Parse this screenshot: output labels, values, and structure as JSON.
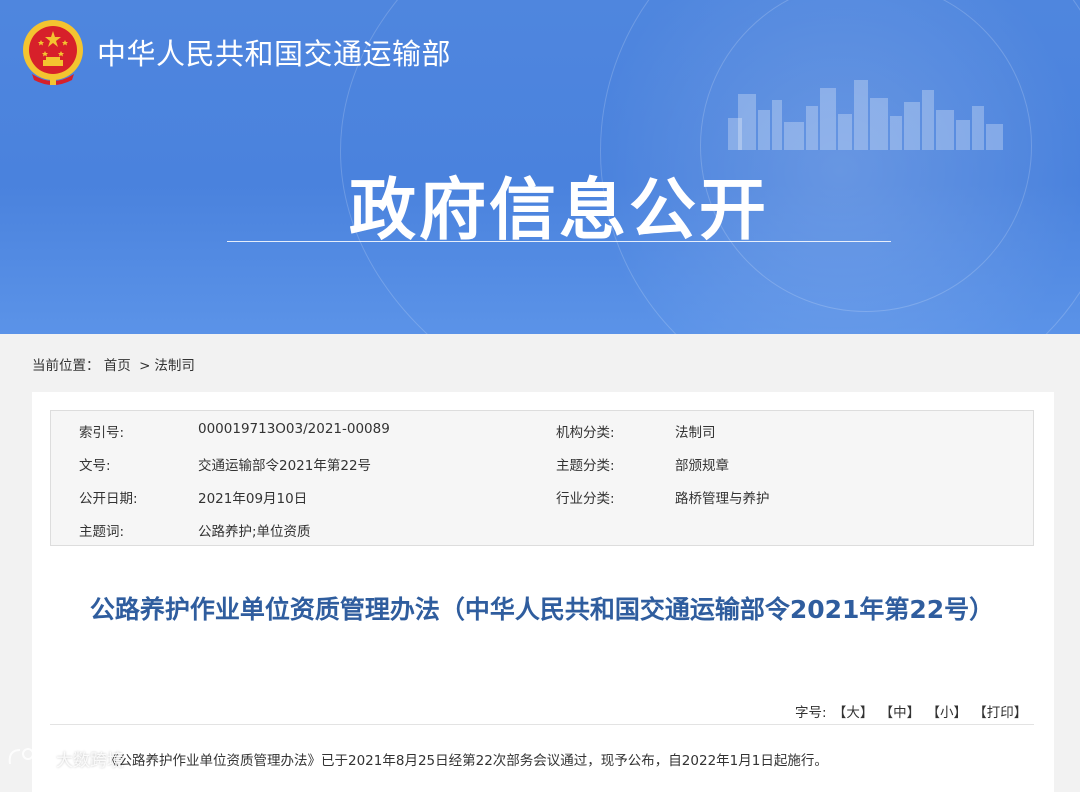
{
  "header": {
    "ministry_name": "中华人民共和国交通运输部",
    "banner_title": "政府信息公开",
    "emblem_icon": "national-emblem-icon"
  },
  "breadcrumb": {
    "label": "当前位置：",
    "items": [
      "首页",
      "法制司"
    ],
    "separator": ">"
  },
  "meta": {
    "index_label": "索引号:",
    "index_value": "000019713O03/2021-00089",
    "org_label": "机构分类:",
    "org_value": "法制司",
    "docno_label": "文号:",
    "docno_value": "交通运输部令2021年第22号",
    "topic_label": "主题分类:",
    "topic_value": "部颁规章",
    "date_label": "公开日期:",
    "date_value": "2021年09月10日",
    "industry_label": "行业分类:",
    "industry_value": "路桥管理与养护",
    "keywords_label": "主题词:",
    "keywords_value": "公路养护;单位资质"
  },
  "document": {
    "title": "公路养护作业单位资质管理办法（中华人民共和国交通运输部令2021年第22号）"
  },
  "font_tools": {
    "label": "字号:",
    "large": "【大】",
    "medium": "【中】",
    "small": "【小】",
    "print": "【打印】"
  },
  "body": {
    "text": "《公路养护作业单位资质管理办法》已于2021年8月25日经第22次部务会议通过，现予公布，自2022年1月1日起施行。"
  },
  "watermark": {
    "text": "大数跨境"
  },
  "colors": {
    "banner": "#4a82dd",
    "title": "#2f5d9e",
    "emblem_red": "#d7202a",
    "emblem_gold": "#f4c430"
  }
}
